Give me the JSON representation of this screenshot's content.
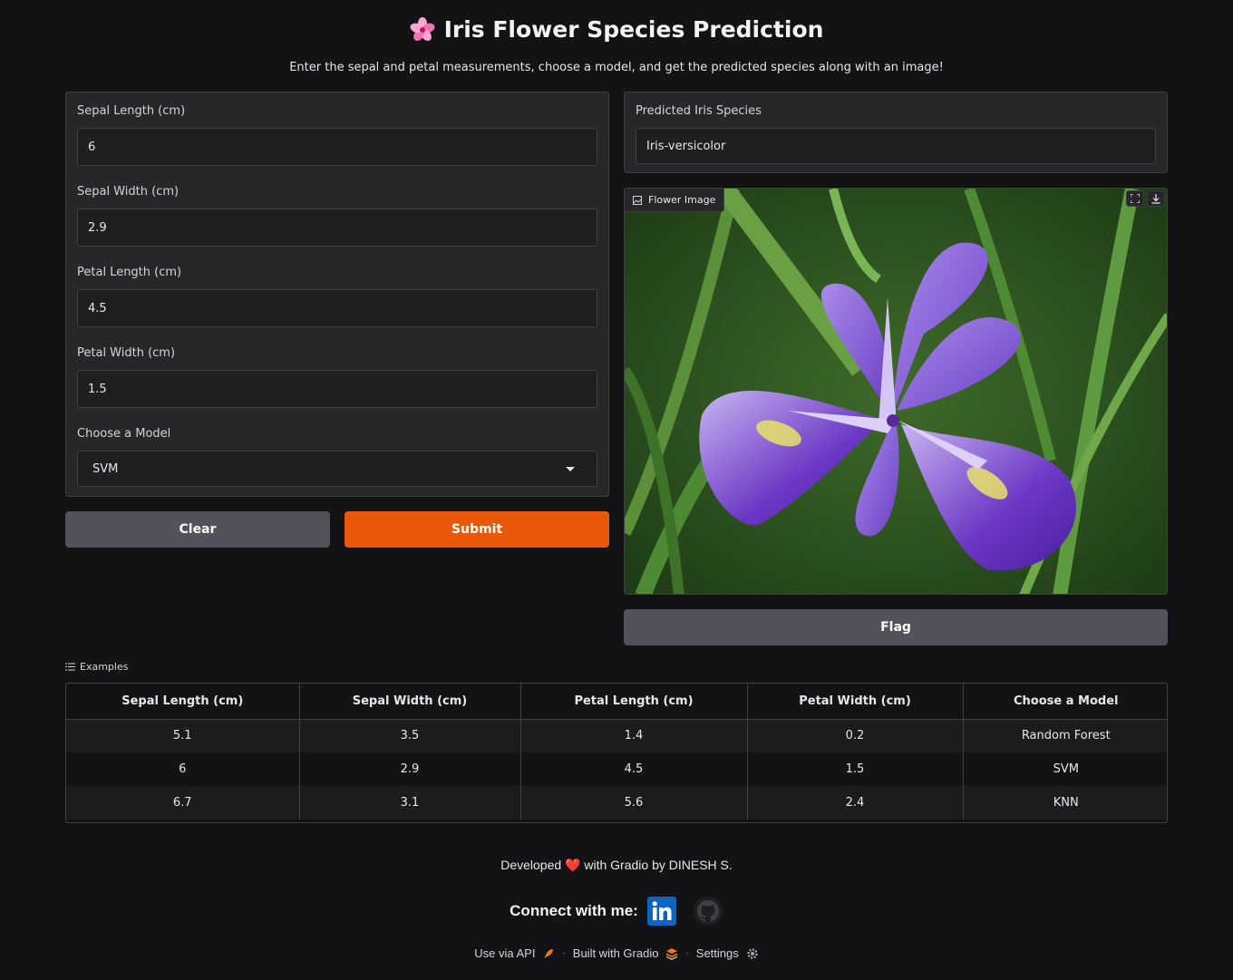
{
  "header": {
    "title": "Iris Flower Species Prediction",
    "title_icon": "cherry-blossom-icon",
    "subtitle": "Enter the sepal and petal measurements, choose a model, and get the predicted species along with an image!"
  },
  "inputs": {
    "sepal_length": {
      "label": "Sepal Length (cm)",
      "value": "6"
    },
    "sepal_width": {
      "label": "Sepal Width (cm)",
      "value": "2.9"
    },
    "petal_length": {
      "label": "Petal Length (cm)",
      "value": "4.5"
    },
    "petal_width": {
      "label": "Petal Width (cm)",
      "value": "1.5"
    },
    "model": {
      "label": "Choose a Model",
      "value": "SVM"
    }
  },
  "buttons": {
    "clear": "Clear",
    "submit": "Submit",
    "flag": "Flag"
  },
  "output": {
    "label": "Predicted Iris Species",
    "value": "Iris-versicolor",
    "image_label": "Flower Image"
  },
  "examples": {
    "label": "Examples",
    "headers": [
      "Sepal Length (cm)",
      "Sepal Width (cm)",
      "Petal Length (cm)",
      "Petal Width (cm)",
      "Choose a Model"
    ],
    "rows": [
      [
        "5.1",
        "3.5",
        "1.4",
        "0.2",
        "Random Forest"
      ],
      [
        "6",
        "2.9",
        "4.5",
        "1.5",
        "SVM"
      ],
      [
        "6.7",
        "3.1",
        "5.6",
        "2.4",
        "KNN"
      ]
    ]
  },
  "footer": {
    "developed_prefix": "Developed",
    "developed_suffix": "with Gradio by DINESH S.",
    "connect": "Connect with me:",
    "use_api": "Use via API",
    "built_with": "Built with Gradio",
    "settings": "Settings"
  },
  "colors": {
    "background": "#131316",
    "panel": "#27272a",
    "primary": "#ea580c",
    "secondary": "#52525b"
  }
}
